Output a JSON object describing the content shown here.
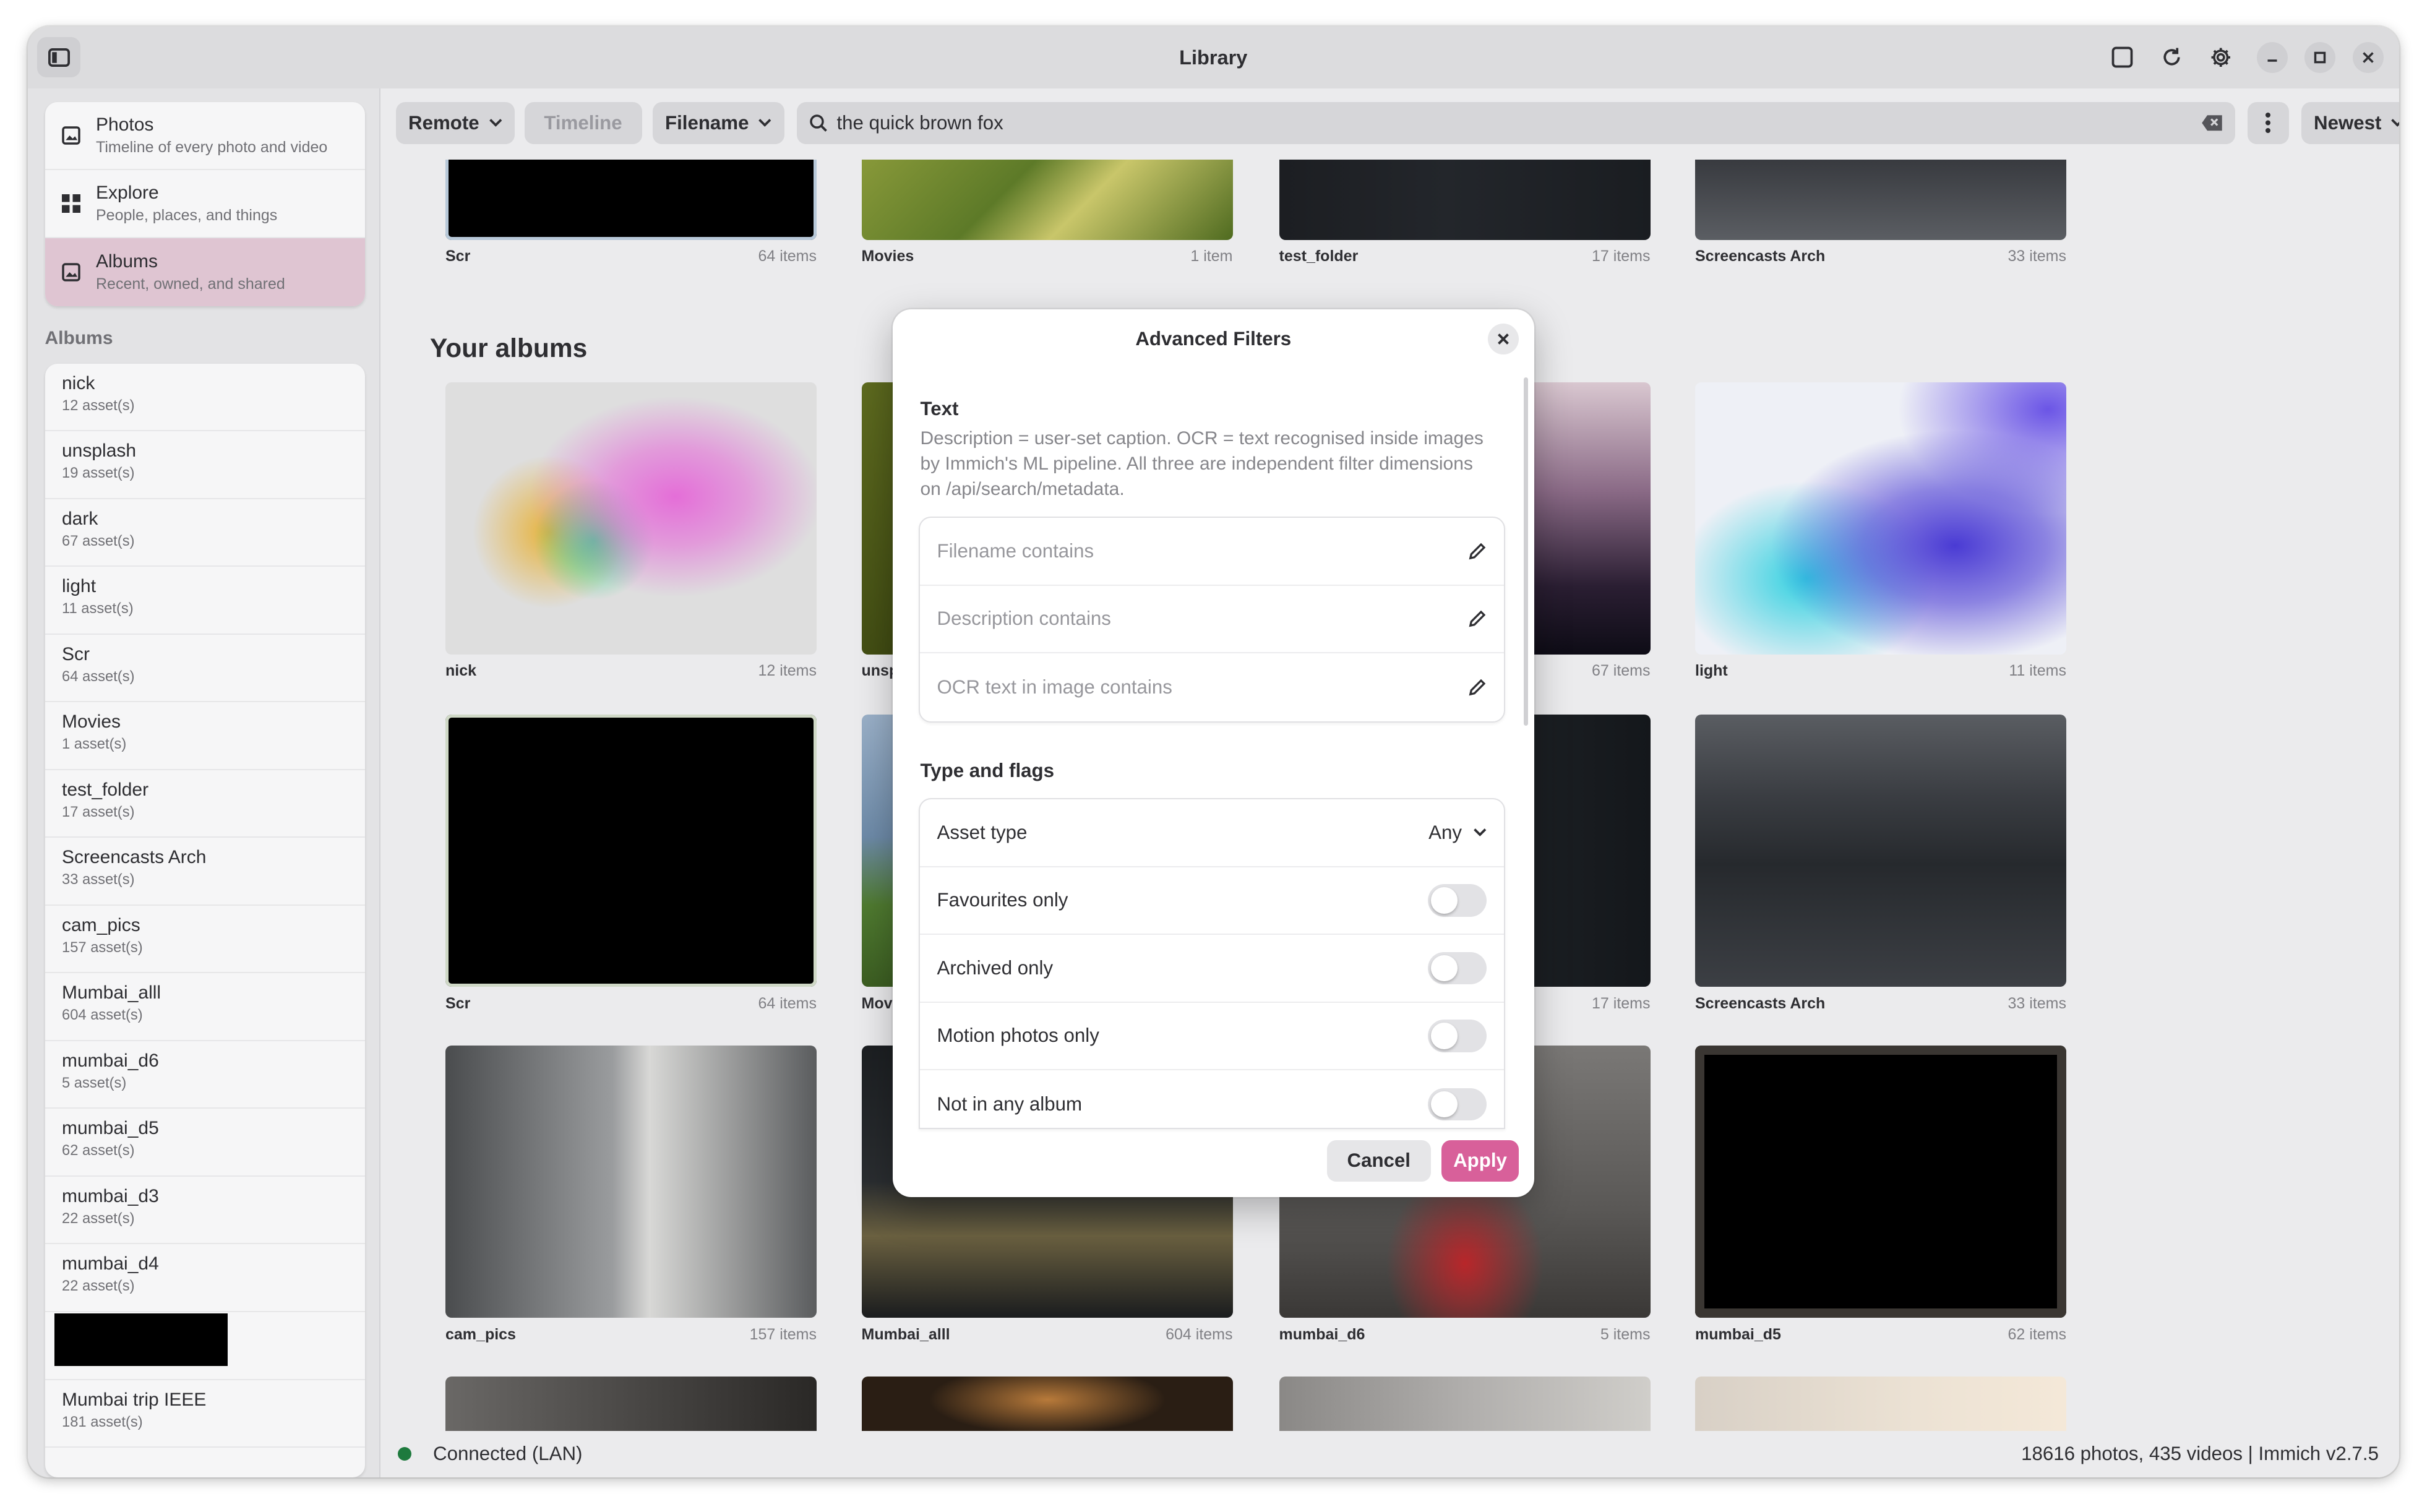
{
  "window": {
    "title": "Library"
  },
  "sidebar": {
    "nav": [
      {
        "title": "Photos",
        "subtitle": "Timeline of every photo and video",
        "icon": "photo-icon",
        "active": false
      },
      {
        "title": "Explore",
        "subtitle": "People, places, and things",
        "icon": "grid-icon",
        "active": false
      },
      {
        "title": "Albums",
        "subtitle": "Recent, owned, and shared",
        "icon": "album-icon",
        "active": true
      }
    ],
    "section_label": "Albums",
    "albums": [
      {
        "name": "nick",
        "count": "12 asset(s)"
      },
      {
        "name": "unsplash",
        "count": "19 asset(s)"
      },
      {
        "name": "dark",
        "count": "67 asset(s)"
      },
      {
        "name": "light",
        "count": "11 asset(s)"
      },
      {
        "name": "Scr",
        "count": "64 asset(s)"
      },
      {
        "name": "Movies",
        "count": "1 asset(s)"
      },
      {
        "name": "test_folder",
        "count": "17 asset(s)"
      },
      {
        "name": "Screencasts Arch",
        "count": "33 asset(s)"
      },
      {
        "name": "cam_pics",
        "count": "157 asset(s)"
      },
      {
        "name": "Mumbai_alll",
        "count": "604 asset(s)"
      },
      {
        "name": "mumbai_d6",
        "count": "5 asset(s)"
      },
      {
        "name": "mumbai_d5",
        "count": "62 asset(s)"
      },
      {
        "name": "mumbai_d3",
        "count": "22 asset(s)"
      },
      {
        "name": "mumbai_d4",
        "count": "22 asset(s)"
      }
    ],
    "last_album": {
      "name": "Mumbai trip IEEE",
      "count": "181 asset(s)"
    }
  },
  "toolbar": {
    "source": "Remote",
    "timeline": "Timeline",
    "search_field": "Filename",
    "search_value": "the quick brown fox",
    "sort": "Newest"
  },
  "main": {
    "section_title": "Your albums",
    "top_row": [
      {
        "name": "Scr",
        "count": "64 items"
      },
      {
        "name": "Movies",
        "count": "1 item"
      },
      {
        "name": "test_folder",
        "count": "17 items"
      },
      {
        "name": "Screencasts Arch",
        "count": "33 items"
      }
    ],
    "row1": [
      {
        "name": "nick",
        "count": "12 items"
      },
      {
        "name": "unsplash",
        "count": ""
      },
      {
        "name": "",
        "count": "67 items"
      },
      {
        "name": "light",
        "count": "11 items"
      }
    ],
    "row2": [
      {
        "name": "Scr",
        "count": "64 items"
      },
      {
        "name": "Movies",
        "count": ""
      },
      {
        "name": "",
        "count": "17 items"
      },
      {
        "name": "Screencasts Arch",
        "count": "33 items"
      }
    ],
    "row3": [
      {
        "name": "cam_pics",
        "count": "157 items"
      },
      {
        "name": "Mumbai_alll",
        "count": "604 items"
      },
      {
        "name": "mumbai_d6",
        "count": "5 items"
      },
      {
        "name": "mumbai_d5",
        "count": "62 items"
      }
    ]
  },
  "status": {
    "connection": "Connected (LAN)",
    "summary": "18616 photos, 435 videos | Immich v2.7.5",
    "dot_color": "#1e7a3e"
  },
  "dialog": {
    "title": "Advanced Filters",
    "text_section": "Text",
    "text_desc": "Description = user-set caption. OCR = text recognised inside images by Immich's ML pipeline. All three are independent filter dimensions on /api/search/metadata.",
    "fields": [
      {
        "placeholder": "Filename contains"
      },
      {
        "placeholder": "Description contains"
      },
      {
        "placeholder": "OCR text in image contains"
      }
    ],
    "flags_section": "Type and flags",
    "asset_type_label": "Asset type",
    "asset_type_value": "Any",
    "toggles": [
      {
        "label": "Favourites only",
        "on": false
      },
      {
        "label": "Archived only",
        "on": false
      },
      {
        "label": "Motion photos only",
        "on": false
      },
      {
        "label": "Not in any album",
        "on": false
      }
    ],
    "cancel": "Cancel",
    "apply": "Apply",
    "accent": "#d8609a"
  }
}
